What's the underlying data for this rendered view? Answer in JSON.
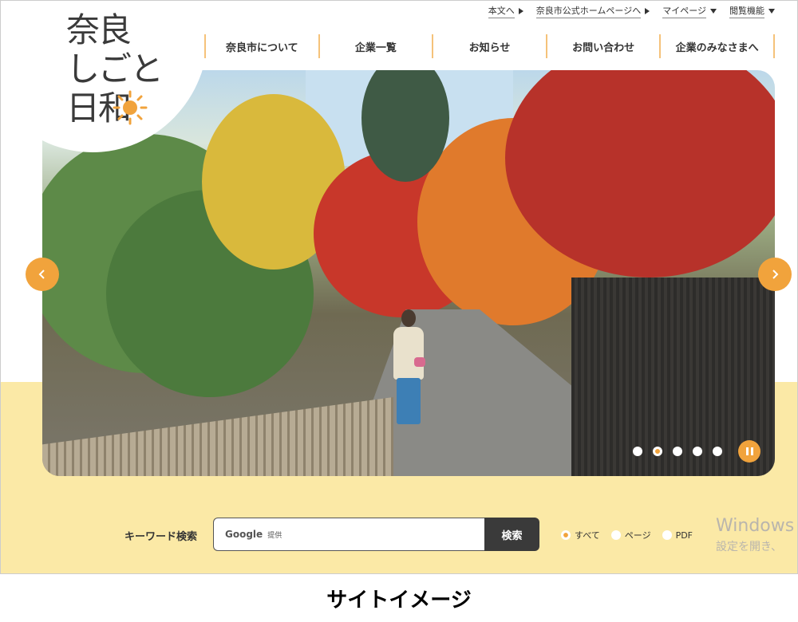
{
  "site": {
    "logo_lines": [
      "奈良",
      "しごと",
      "日和"
    ]
  },
  "util_nav": {
    "items": [
      {
        "label": "本文へ",
        "arrow": "right"
      },
      {
        "label": "奈良市公式ホームページへ",
        "arrow": "right"
      },
      {
        "label": "マイページ",
        "arrow": "down"
      },
      {
        "label": "閲覧機能",
        "arrow": "down"
      }
    ]
  },
  "main_nav": {
    "items": [
      {
        "label": "奈良市について"
      },
      {
        "label": "企業一覧"
      },
      {
        "label": "お知らせ"
      },
      {
        "label": "お問い合わせ"
      },
      {
        "label": "企業のみなさまへ"
      }
    ]
  },
  "slider": {
    "prev_icon": "chevron-left-icon",
    "next_icon": "chevron-right-icon",
    "dots": 5,
    "active_dot": 2,
    "pause_icon": "pause-icon",
    "accent": "#f1a33c"
  },
  "search": {
    "label": "キーワード検索",
    "provider": "Google",
    "provider_suffix": "提供",
    "button": "検索",
    "options": [
      {
        "label": "すべて",
        "selected": true
      },
      {
        "label": "ページ",
        "selected": false
      },
      {
        "label": "PDF",
        "selected": false
      }
    ]
  },
  "watermark": {
    "line1": "Windows",
    "line2": "設定を開き、"
  },
  "caption": "サイトイメージ",
  "colors": {
    "accent": "#f1a33c",
    "yellow": "#fbe9a6",
    "dark": "#3a3a3a"
  }
}
